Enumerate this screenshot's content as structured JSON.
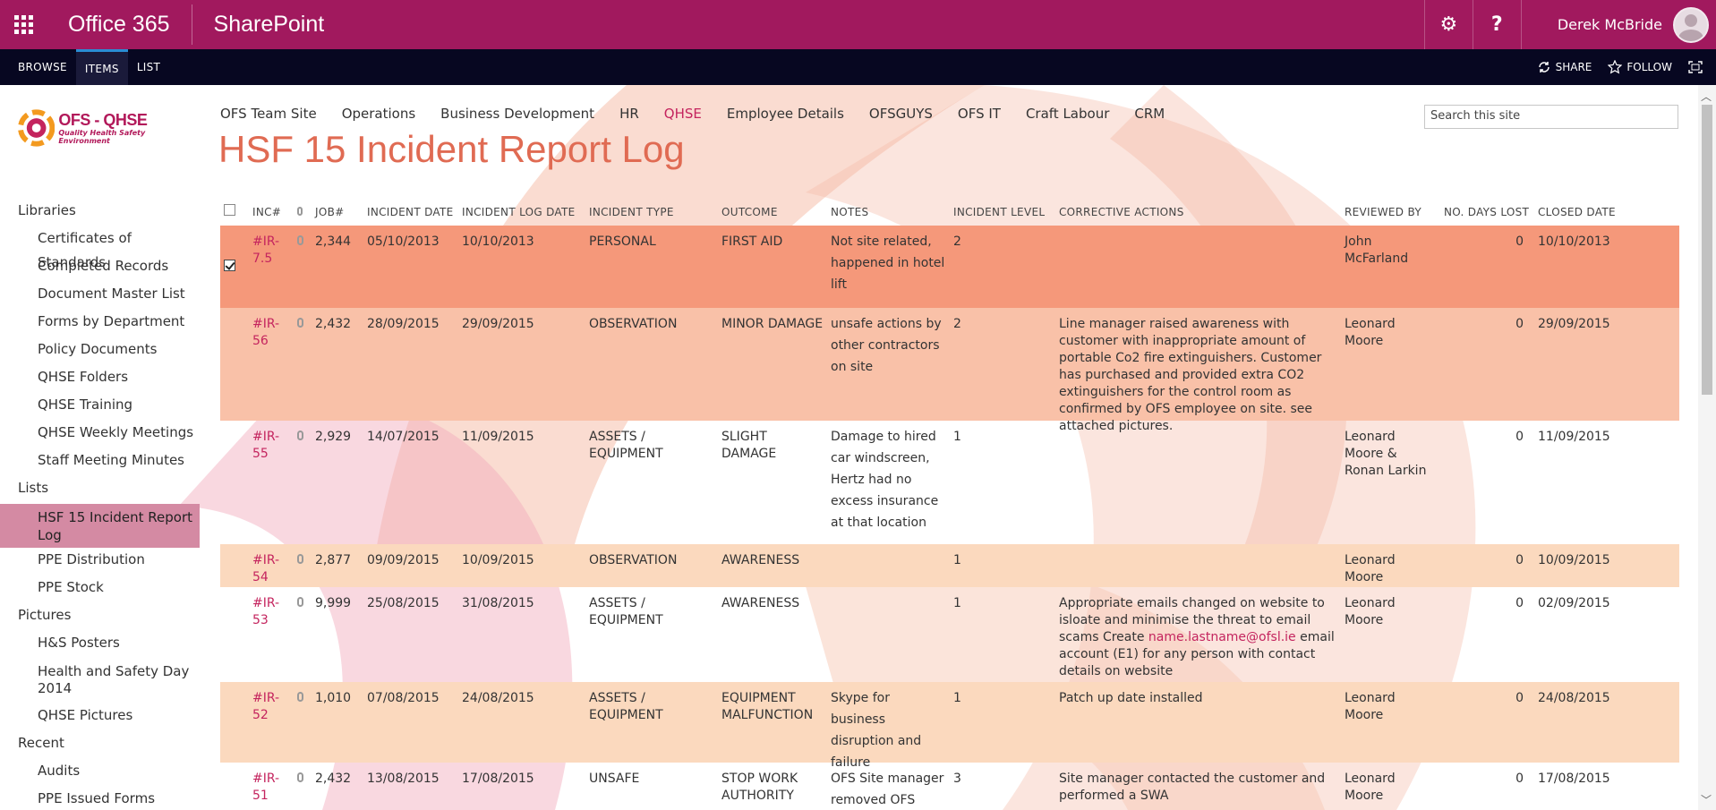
{
  "suite": {
    "brand": "Office 365",
    "app": "SharePoint",
    "user": "Derek McBride",
    "settings_glyph": "⚙",
    "help_glyph": "?"
  },
  "ribbon": {
    "tabs": [
      "BROWSE",
      "ITEMS",
      "LIST"
    ],
    "share": "SHARE",
    "follow": "FOLLOW"
  },
  "logo": {
    "title": "OFS - QHSE",
    "subtitle": "Quality Health Safety Environment"
  },
  "topnav": [
    "OFS Team Site",
    "Operations",
    "Business Development",
    "HR",
    "QHSE",
    "Employee Details",
    "OFSGUYS",
    "OFS IT",
    "Craft Labour",
    "CRM"
  ],
  "search": {
    "placeholder": "Search this site"
  },
  "page_title": "HSF 15 Incident Report Log",
  "leftnav": {
    "libraries": "Libraries",
    "library_items": [
      "Certificates of Standards",
      "Completed Records",
      "Document Master List",
      "Forms by Department",
      "Policy Documents",
      "QHSE Folders",
      "QHSE Training",
      "QHSE Weekly Meetings",
      "Staff Meeting Minutes"
    ],
    "lists": "Lists",
    "list_items": [
      "HSF 15 Incident Report Log",
      "PPE Distribution",
      "PPE Stock"
    ],
    "pictures": "Pictures",
    "picture_items": [
      "H&S Posters",
      "Health and Safety Day 2014",
      "QHSE Pictures"
    ],
    "recent": "Recent",
    "recent_items": [
      "Audits",
      "PPE Issued Forms"
    ]
  },
  "columns": {
    "inc": "INC#",
    "job": "JOB#",
    "incident_date": "INCIDENT DATE",
    "log_date": "INCIDENT LOG DATE",
    "type": "INCIDENT TYPE",
    "outcome": "OUTCOME",
    "notes": "NOTES",
    "level": "INCIDENT LEVEL",
    "corrective": "CORRECTIVE ACTIONS",
    "reviewed": "REVIEWED BY",
    "days_lost": "NO. DAYS LOST",
    "closed": "CLOSED DATE"
  },
  "rows": [
    {
      "inc": "#IR-7.5",
      "job": "2,344",
      "date": "05/10/2013",
      "log": "10/10/2013",
      "type": "PERSONAL",
      "outcome": "FIRST AID",
      "notes": "Not site related, happened in hotel lift",
      "level": "2",
      "corrective": "",
      "reviewed": "John McFarland",
      "days": "0",
      "closed": "10/10/2013",
      "bg": "#f5987a",
      "checked": true,
      "h": 92
    },
    {
      "inc": "#IR-56",
      "job": "2,432",
      "date": "28/09/2015",
      "log": "29/09/2015",
      "type": "OBSERVATION",
      "outcome": "MINOR DAMAGE",
      "notes": "unsafe actions by other contractors on site",
      "level": "2",
      "corrective": "Line manager raised awareness with customer with inappropriate amount of portable Co2 fire extinguishers. Customer has purchased and provided extra CO2 extinguishers for the control room as confirmed by OFS employee on site. see attached pictures.",
      "reviewed": "Leonard Moore",
      "days": "0",
      "closed": "29/09/2015",
      "bg": "#f9c1a8",
      "checked": false,
      "h": 126
    },
    {
      "inc": "#IR-55",
      "job": "2,929",
      "date": "14/07/2015",
      "log": "11/09/2015",
      "type": "ASSETS / EQUIPMENT",
      "outcome": "SLIGHT DAMAGE",
      "notes": "Damage to hired car windscreen, Hertz had no excess insurance at that location",
      "level": "1",
      "corrective": "",
      "reviewed": "Leonard Moore & Ronan Larkin",
      "days": "0",
      "closed": "11/09/2015",
      "bg": "transparent",
      "checked": false,
      "h": 138
    },
    {
      "inc": "#IR-54",
      "job": "2,877",
      "date": "09/09/2015",
      "log": "10/09/2015",
      "type": "OBSERVATION",
      "outcome": "AWARENESS",
      "notes": "",
      "level": "1",
      "corrective": "",
      "reviewed": "Leonard Moore",
      "days": "0",
      "closed": "10/09/2015",
      "bg": "#fbd9be",
      "checked": false,
      "h": 48
    },
    {
      "inc": "#IR-53",
      "job": "9,999",
      "date": "25/08/2015",
      "log": "31/08/2015",
      "type": "ASSETS / EQUIPMENT",
      "outcome": "AWARENESS",
      "notes": "",
      "level": "1",
      "corrective_pre": "Appropriate emails changed on website to isloate and minimise the threat to email scams Create ",
      "corrective_link": "name.lastname@ofsl.ie",
      "corrective_post": " email account (E1) for any person with contact details on website",
      "reviewed": "Leonard Moore",
      "days": "0",
      "closed": "02/09/2015",
      "bg": "transparent",
      "checked": false,
      "h": 106
    },
    {
      "inc": "#IR-52",
      "job": "1,010",
      "date": "07/08/2015",
      "log": "24/08/2015",
      "type": "ASSETS / EQUIPMENT",
      "outcome": "EQUIPMENT MALFUNCTION",
      "notes": "Skype for business disruption and failure",
      "level": "1",
      "corrective": "Patch up date installed",
      "reviewed": "Leonard Moore",
      "days": "0",
      "closed": "24/08/2015",
      "bg": "#fbd9be",
      "checked": false,
      "h": 90
    },
    {
      "inc": "#IR-51",
      "job": "2,432",
      "date": "13/08/2015",
      "log": "17/08/2015",
      "type": "UNSAFE",
      "outcome": "STOP WORK AUTHORITY",
      "notes": "OFS Site manager removed OFS",
      "level": "3",
      "corrective": "Site manager contacted the customer and performed a SWA",
      "reviewed": "Leonard Moore",
      "days": "0",
      "closed": "17/08/2015",
      "bg": "transparent",
      "checked": false,
      "h": 60
    }
  ],
  "colors": {
    "suitebar": "#a1195e",
    "ribbon": "#070721",
    "title": "#e06b53",
    "link": "#c4245e"
  }
}
